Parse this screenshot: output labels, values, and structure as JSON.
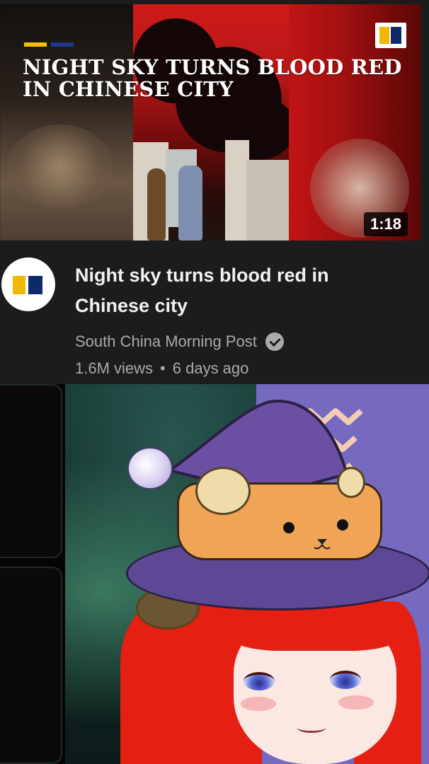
{
  "video": {
    "thumbnail_title": "NIGHT SKY TURNS BLOOD RED IN CHINESE CITY",
    "duration": "1:18",
    "title": "Night sky turns blood red in Chinese city",
    "channel": "South China Morning Post",
    "views": "1.6M views",
    "separator": "•",
    "age": "6 days ago",
    "verified_icon": "check-circle-icon",
    "brand_colors": {
      "yellow": "#f2b800",
      "navy": "#0f2a6b"
    }
  },
  "stream": {
    "colors": {
      "hat": "#5d4896",
      "band": "#f0a556",
      "hair": "#e51f12",
      "background_right": "#7669c0"
    }
  }
}
